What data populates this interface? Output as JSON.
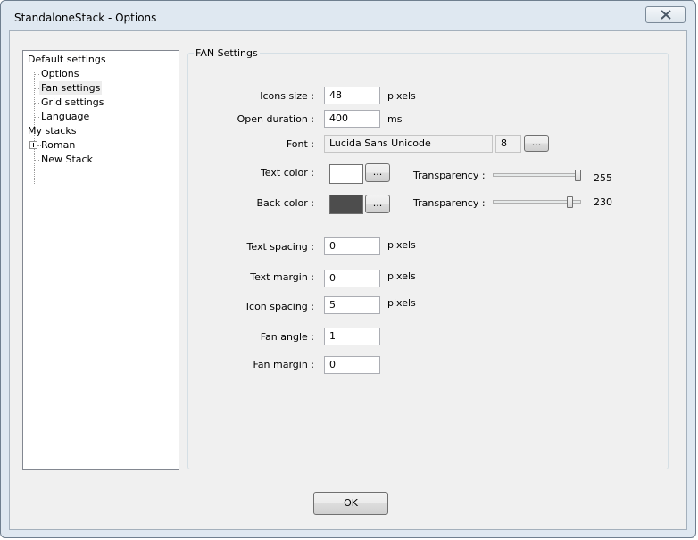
{
  "window": {
    "title": "StandaloneStack - Options"
  },
  "tree": {
    "default_settings": "Default settings",
    "options": "Options",
    "fan_settings": "Fan settings",
    "grid_settings": "Grid settings",
    "language": "Language",
    "my_stacks": "My stacks",
    "roman": "Roman",
    "new_stack": "New Stack",
    "selected": "Fan settings"
  },
  "fan": {
    "group_title": "FAN Settings",
    "icons_size": {
      "label": "Icons size :",
      "value": "48",
      "unit": "pixels"
    },
    "open_duration": {
      "label": "Open duration :",
      "value": "400",
      "unit": "ms"
    },
    "font": {
      "label": "Font :",
      "name": "Lucida Sans Unicode",
      "size": "8",
      "button": "..."
    },
    "text_color": {
      "label": "Text color :",
      "color": "#ffffff",
      "button": "...",
      "transparency_label": "Transparency :",
      "transparency_value": "255",
      "transparency_fraction": 1.0
    },
    "back_color": {
      "label": "Back color :",
      "color": "#4d4d4d",
      "button": "...",
      "transparency_label": "Transparency :",
      "transparency_value": "230",
      "transparency_fraction": 0.902
    },
    "text_spacing": {
      "label": "Text spacing :",
      "value": "0",
      "unit": "pixels"
    },
    "text_margin": {
      "label": "Text margin :",
      "value": "0",
      "unit": "pixels"
    },
    "icon_spacing": {
      "label": "Icon spacing :",
      "value": "5",
      "unit": "pixels"
    },
    "fan_angle": {
      "label": "Fan angle :",
      "value": "1"
    },
    "fan_margin": {
      "label": "Fan margin :",
      "value": "0"
    }
  },
  "footer": {
    "ok_label": "OK"
  }
}
